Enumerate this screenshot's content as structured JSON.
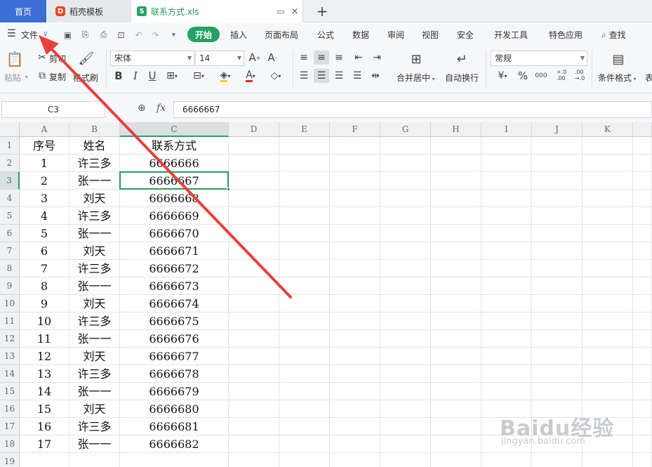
{
  "tabs": {
    "home": "首页",
    "template": "稻壳模板",
    "file": "联系方式.xls",
    "template_logo": "D",
    "file_logo": "S"
  },
  "menu": {
    "file": "文件",
    "items": [
      "开始",
      "插入",
      "页面布局",
      "公式",
      "数据",
      "审阅",
      "视图",
      "安全",
      "开发工具",
      "特色应用"
    ],
    "search": "查找"
  },
  "ribbon": {
    "paste": "粘贴",
    "cut": "剪切",
    "copy": "复制",
    "format_painter": "格式刷",
    "font_name": "宋体",
    "font_size": "14",
    "merge_center": "合并居中",
    "wrap_text": "自动换行",
    "number_format": "常规",
    "conditional_format": "条件格式",
    "table_style": "表",
    "decimals_increase": "+.0\n.00",
    "thousands": "000",
    "percent": "%",
    "currency": "¥"
  },
  "formula_bar": {
    "name_box": "C3",
    "fx_label": "fx",
    "content": "6666667"
  },
  "sheet": {
    "columns": [
      "A",
      "B",
      "C",
      "D",
      "E",
      "F",
      "G",
      "H",
      "I",
      "J",
      "K"
    ],
    "row_numbers": [
      "1",
      "2",
      "3",
      "4",
      "5",
      "6",
      "7",
      "8",
      "9",
      "10",
      "11",
      "12",
      "13",
      "14",
      "15",
      "16",
      "17",
      "18",
      "19"
    ],
    "header": [
      "序号",
      "姓名",
      "联系方式"
    ],
    "rows": [
      [
        "1",
        "许三多",
        "6666666"
      ],
      [
        "2",
        "张一一",
        "6666667"
      ],
      [
        "3",
        "刘天",
        "6666668"
      ],
      [
        "4",
        "许三多",
        "6666669"
      ],
      [
        "5",
        "张一一",
        "6666670"
      ],
      [
        "6",
        "刘天",
        "6666671"
      ],
      [
        "7",
        "许三多",
        "6666672"
      ],
      [
        "8",
        "张一一",
        "6666673"
      ],
      [
        "9",
        "刘天",
        "6666674"
      ],
      [
        "10",
        "许三多",
        "6666675"
      ],
      [
        "11",
        "张一一",
        "6666676"
      ],
      [
        "12",
        "刘天",
        "6666677"
      ],
      [
        "13",
        "许三多",
        "6666678"
      ],
      [
        "14",
        "张一一",
        "6666679"
      ],
      [
        "15",
        "刘天",
        "6666680"
      ],
      [
        "16",
        "许三多",
        "6666681"
      ],
      [
        "17",
        "张一一",
        "6666682"
      ]
    ],
    "active_cell": "C3"
  },
  "watermark": {
    "logo": "Baidu经验",
    "url": "jingyan.baidu.com"
  },
  "colors": {
    "accent_green": "#25a162",
    "home_tab_blue": "#3b6fd6",
    "annotation_arrow": "#e8403a"
  }
}
